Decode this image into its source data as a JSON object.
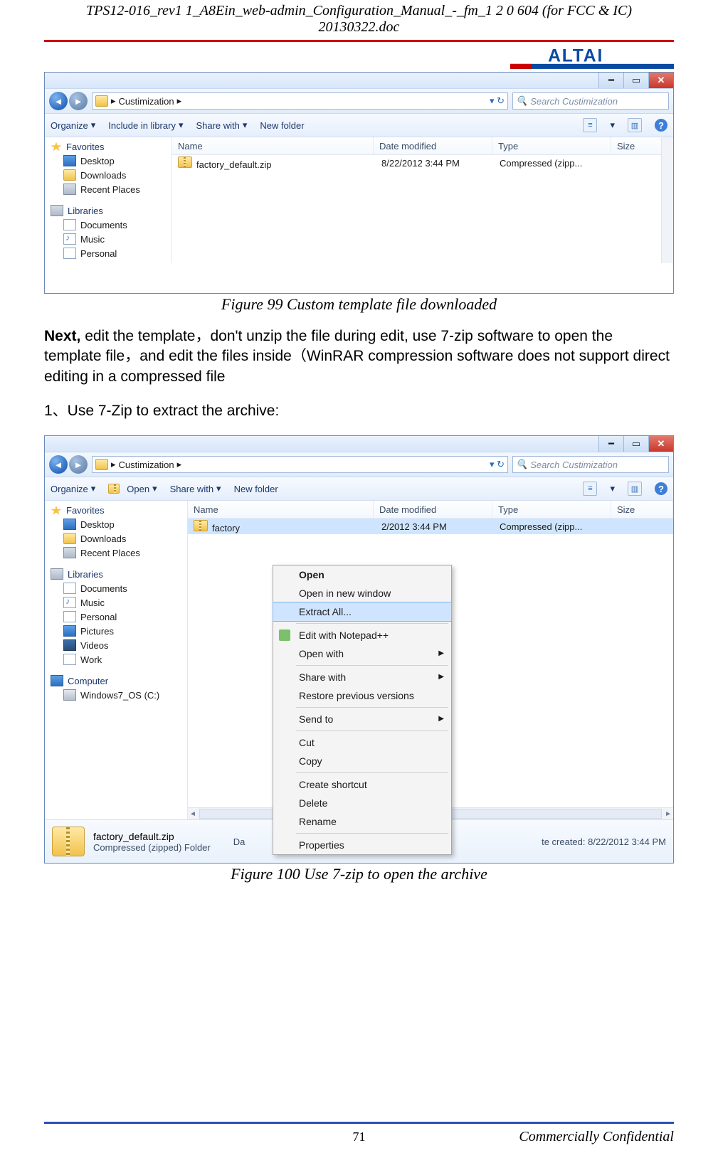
{
  "header": {
    "doc_title": "TPS12-016_rev1 1_A8Ein_web-admin_Configuration_Manual_-_fm_1 2 0 604 (for FCC & IC) 20130322.doc",
    "logo_text": "ALTAI"
  },
  "figure1": {
    "caption": "Figure 99 Custom template file downloaded",
    "breadcrumb": "Custimization",
    "search_placeholder": "Search Custimization",
    "toolbar": {
      "organize": "Organize",
      "include": "Include in library",
      "share": "Share with",
      "newfolder": "New folder"
    },
    "columns": {
      "name": "Name",
      "date": "Date modified",
      "type": "Type",
      "size": "Size"
    },
    "file": {
      "name": "factory_default.zip",
      "date": "8/22/2012 3:44 PM",
      "type": "Compressed (zipp..."
    },
    "sidebar": {
      "favorites": "Favorites",
      "items_fav": [
        "Desktop",
        "Downloads",
        "Recent Places"
      ],
      "libraries": "Libraries",
      "items_lib": [
        "Documents",
        "Music",
        "Personal"
      ]
    }
  },
  "para1_prefix": "Next,",
  "para1_rest": " edit the template，don't unzip the file during edit, use 7-zip software to open the template file，and edit the files inside（WinRAR compression software does not support direct editing in a compressed file",
  "step1": "1、Use 7-Zip to extract the archive:",
  "figure2": {
    "caption": "Figure 100 Use 7-zip to open the archive",
    "breadcrumb": "Custimization",
    "search_placeholder": "Search Custimization",
    "toolbar": {
      "organize": "Organize",
      "open": "Open",
      "share": "Share with",
      "newfolder": "New folder"
    },
    "columns": {
      "name": "Name",
      "date": "Date modified",
      "type": "Type",
      "size": "Size"
    },
    "file": {
      "name": "factory",
      "date": "2/2012 3:44 PM",
      "type": "Compressed (zipp..."
    },
    "sidebar": {
      "favorites": "Favorites",
      "items_fav": [
        "Desktop",
        "Downloads",
        "Recent Places"
      ],
      "libraries": "Libraries",
      "items_lib": [
        "Documents",
        "Music",
        "Personal",
        "Pictures",
        "Videos",
        "Work"
      ],
      "computer": "Computer",
      "drive": "Windows7_OS (C:)"
    },
    "context_menu": [
      "Open",
      "Open in new window",
      "Extract All...",
      "Edit with Notepad++",
      "Open with",
      "Share with",
      "Restore previous versions",
      "Send to",
      "Cut",
      "Copy",
      "Create shortcut",
      "Delete",
      "Rename",
      "Properties"
    ],
    "details": {
      "filename": "factory_default.zip",
      "subtitle": "Compressed (zipped) Folder",
      "da_label": "Da",
      "created_label": "te created:",
      "created": "8/22/2012 3:44 PM"
    }
  },
  "footer": {
    "page": "71",
    "confidential": "Commercially Confidential"
  }
}
